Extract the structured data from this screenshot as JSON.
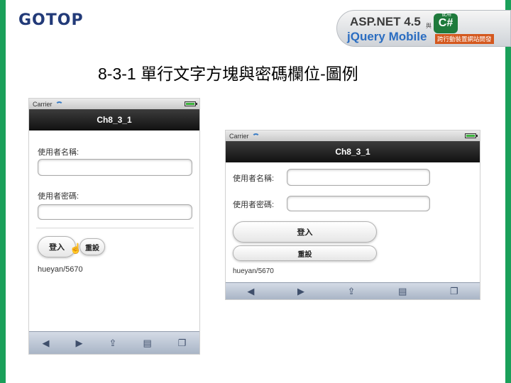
{
  "brand": {
    "logo_text": "GOTOP",
    "book_line1": "ASP.NET 4.5",
    "book_line2": "jQuery Mobile",
    "book_and": "與",
    "book_use": "使用",
    "book_lang": "C#",
    "book_subtitle": "跨行動裝置網站開發"
  },
  "slide": {
    "title": "8-3-1 單行文字方塊與密碼欄位-圖例"
  },
  "phone_portrait": {
    "carrier": "Carrier",
    "header_title": "Ch8_3_1",
    "username_label": "使用者名稱:",
    "password_label": "使用者密碼:",
    "login_label": "登入",
    "reset_label": "重設",
    "result": "hueyan/5670"
  },
  "phone_landscape": {
    "carrier": "Carrier",
    "header_title": "Ch8_3_1",
    "username_label": "使用者名稱:",
    "password_label": "使用者密碼:",
    "login_label": "登入",
    "reset_label": "重設",
    "result": "hueyan/5670"
  },
  "toolbar_icons": [
    "back-arrow-icon",
    "forward-arrow-icon",
    "share-icon",
    "bookmarks-icon",
    "tabs-icon"
  ],
  "colors": {
    "edge_green": "#1aa05a",
    "header_dark": "#111111",
    "logo_blue": "#223a78"
  }
}
